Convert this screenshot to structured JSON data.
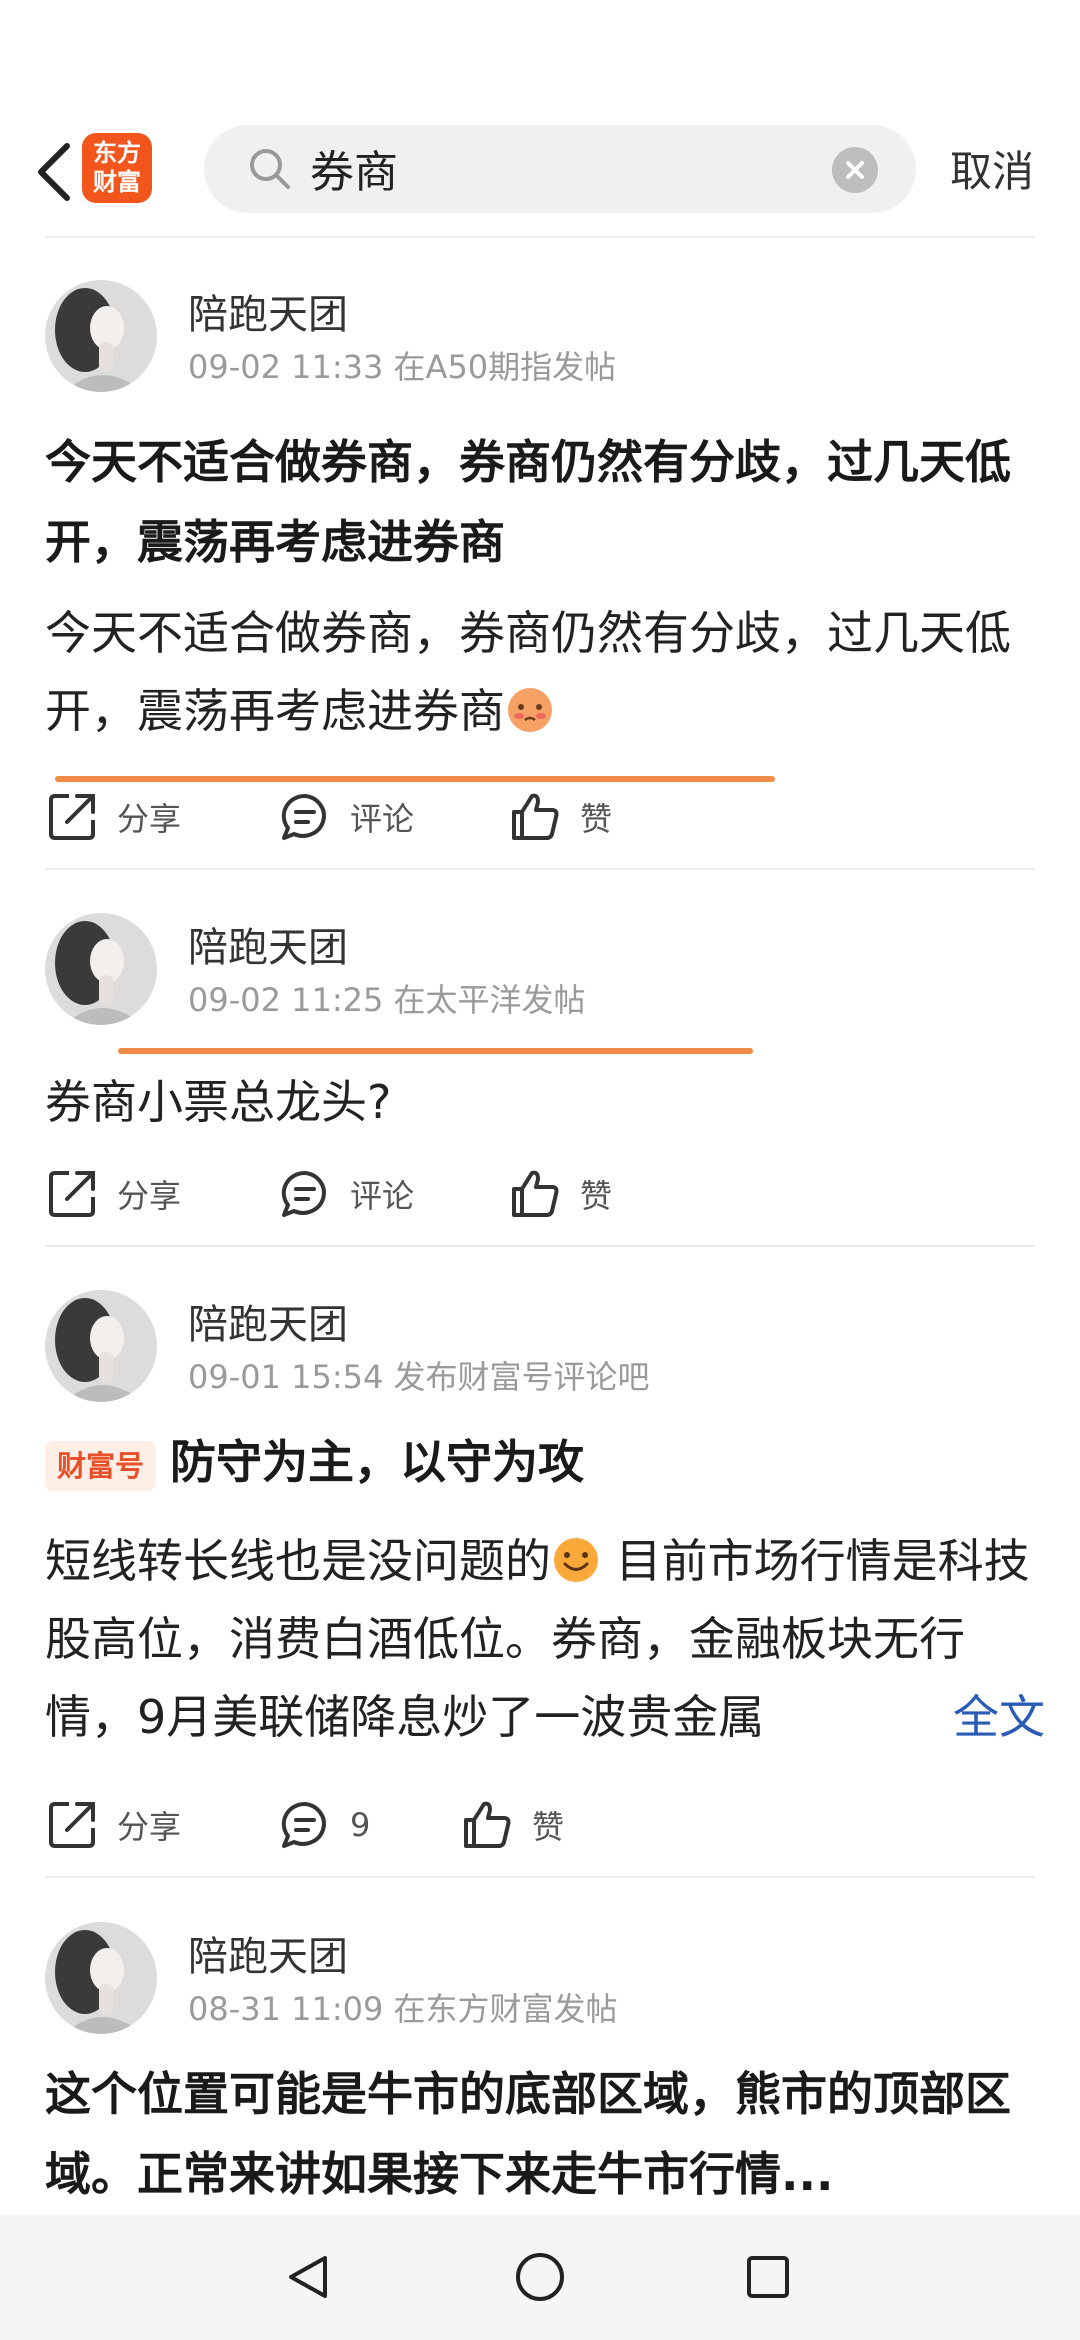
{
  "header": {
    "logo_text_line1": "东方",
    "logo_text_line2": "财富",
    "search_value": "券商",
    "cancel_label": "取消"
  },
  "posts": [
    {
      "author": "陪跑天团",
      "meta": "09-02 11:33  在A50期指发帖",
      "title": "今天不适合做券商，券商仍然有分歧，过几天低开，震荡再考虑进券商",
      "body": "今天不适合做券商，券商仍然有分歧，过几天低开，震荡再考虑进券商",
      "share_label": "分享",
      "comment_label": "评论",
      "like_label": "赞"
    },
    {
      "author": "陪跑天团",
      "meta": "09-02 11:25  在太平洋发帖",
      "body": "券商小票总龙头?",
      "share_label": "分享",
      "comment_label": "评论",
      "like_label": "赞"
    },
    {
      "author": "陪跑天团",
      "meta": "09-01 15:54  发布财富号评论吧",
      "badge": "财富号",
      "title": "防守为主，以守为攻",
      "body_part1": "短线转长线也是没问题的",
      "body_part2": " 目前市场行情是科技股高位，消费白酒低位。券商，金融板块无行情，9月美联储降息炒了一波贵金属",
      "fulltext_label": "全文",
      "share_label": "分享",
      "comment_label": "9",
      "like_label": "赞"
    },
    {
      "author": "陪跑天团",
      "meta": "08-31 11:09  在东方财富发帖",
      "title": "这个位置可能是牛市的底部区域，熊市的顶部区域。正常来讲如果接下来走牛市行情..."
    }
  ],
  "colors": {
    "brand": "#f2561d",
    "highlight_underline": "#ef8c45",
    "link": "#2a5bb5"
  }
}
